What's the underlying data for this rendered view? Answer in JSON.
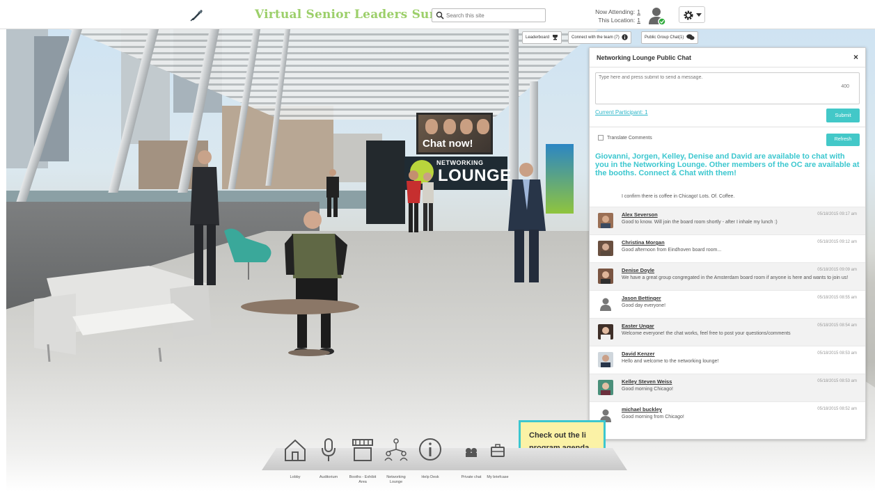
{
  "header": {
    "title": "Virtual Senior Leaders Summit",
    "search_placeholder": "Search this site",
    "now_attending_label": "Now Attending:",
    "now_attending_value": "1",
    "this_location_label": "This Location:",
    "this_location_value": "1"
  },
  "icons": {
    "logo": "feather-pen-icon",
    "search": "search-icon",
    "user": "user-online-icon",
    "settings": "gear-icon"
  },
  "toolbar": {
    "leaderboard": "Leaderboard",
    "connect_team": "Connect with the team (7)",
    "public_chat": "Public Group Chat(1)"
  },
  "scene": {
    "chat_now": "Chat now!",
    "lounge_small": "NETWORKING",
    "lounge_big": "LOUNGE"
  },
  "chat": {
    "title": "Networking Lounge Public Chat",
    "close": "×",
    "placeholder": "Type here and press submit to send a message.",
    "char_count": "400",
    "participants": "Current Participant: 1",
    "submit": "Submit",
    "translate": "Translate Comments",
    "refresh": "Refresh",
    "announcement": "Giovanni, Jorgen, Kelley, Denise and David are available to chat with you in the Networking Lounge. Other members of the OC are available at the booths. Connect & Chat with them!",
    "first_message": "I confirm there is coffee in Chicago!  Lots. Of. Coffee.",
    "messages": [
      {
        "name": "Alex Severson",
        "time": "05/18/2015 09:17 am",
        "text": "Good to know. Will join the board room shortly - after I inhale my lunch :)"
      },
      {
        "name": "Christina Morgan",
        "time": "05/18/2015 09:12 am",
        "text": "Good afternoon from Eindhoven board room..."
      },
      {
        "name": "Denise Doyle",
        "time": "05/18/2015 09:09 am",
        "text": "We have a great group congregated in the Amsterdam board room if anyone is here and wants to join us!"
      },
      {
        "name": "Jason Bettinger",
        "time": "05/18/2015 08:55 am",
        "text": "Good day everyone!"
      },
      {
        "name": "Easter Ungar",
        "time": "05/18/2015 08:54 am",
        "text": "Welcome everyone! the chat works, feel free to post your questions/comments"
      },
      {
        "name": "David Kenzer",
        "time": "05/18/2015 08:53 am",
        "text": "Hello and welcome to the networking lounge!"
      },
      {
        "name": "Kelley Steven Weiss",
        "time": "05/18/2015 08:53 am",
        "text": "Good morning Chicago!"
      },
      {
        "name": "michael buckley",
        "time": "05/18/2015 08:52 am",
        "text": "Good morning from Chicago!"
      }
    ]
  },
  "agenda": {
    "line1": "Check out the li",
    "line2": "program agenda"
  },
  "nav": {
    "items": [
      {
        "label": "Lobby",
        "icon": "house-icon"
      },
      {
        "label": "Auditorium",
        "icon": "microphone-icon"
      },
      {
        "label": "Booths - Exhibit Area",
        "icon": "booth-icon"
      },
      {
        "label": "Networking Lounge",
        "icon": "network-people-icon"
      },
      {
        "label": "Help Desk",
        "icon": "info-icon"
      },
      {
        "label": "Private chat",
        "icon": "private-chat-icon"
      },
      {
        "label": "My briefcase",
        "icon": "briefcase-icon"
      }
    ]
  },
  "colors": {
    "title_green": "#9ccf6a",
    "accent_teal": "#43c8c8",
    "announce_teal": "#3cc7cf",
    "agenda_yellow": "#fbf2a6"
  }
}
